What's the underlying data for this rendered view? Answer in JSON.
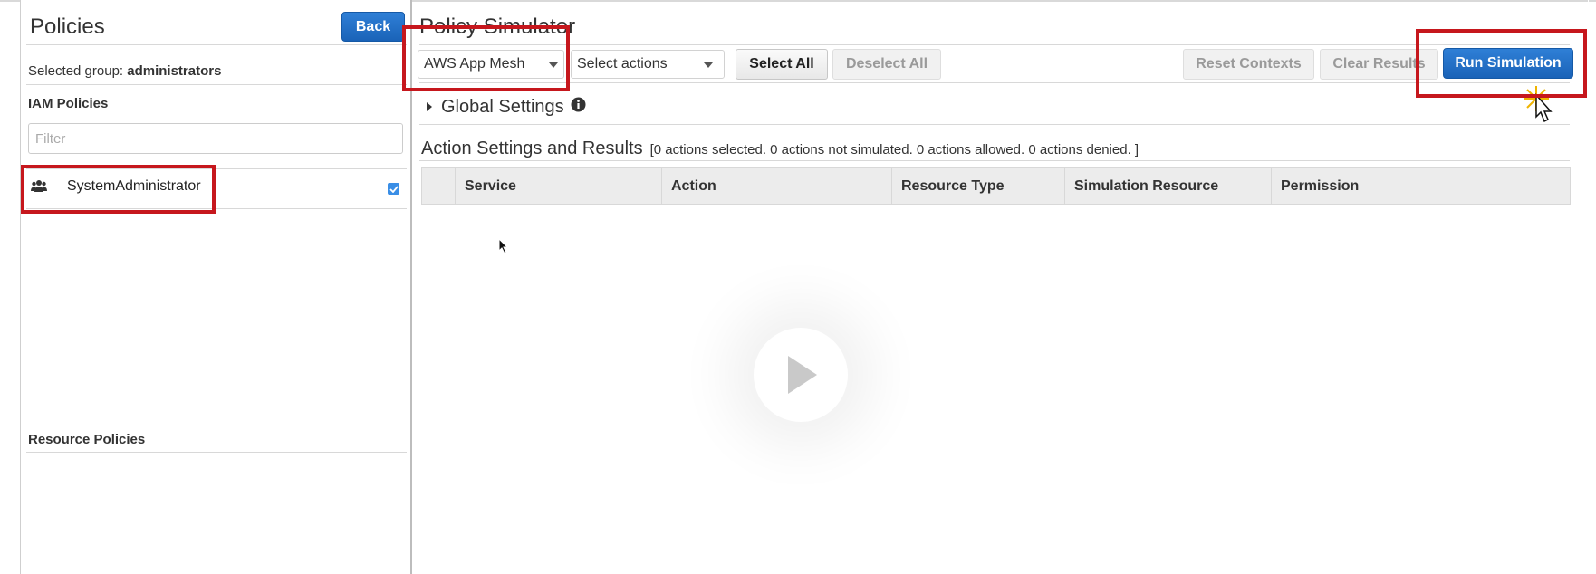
{
  "left": {
    "title": "Policies",
    "back_label": "Back",
    "selected_group_label": "Selected group: ",
    "selected_group_name": "administrators",
    "iam_policies_heading": "IAM Policies",
    "filter_placeholder": "Filter",
    "policies": [
      {
        "name": "SystemAdministrator",
        "checked": true,
        "icon": "users-icon"
      }
    ],
    "resource_policies_heading": "Resource Policies"
  },
  "main": {
    "title": "Policy Simulator",
    "service_select_value": "AWS App Mesh",
    "actions_select_value": "Select actions",
    "select_all_label": "Select All",
    "deselect_all_label": "Deselect All",
    "reset_contexts_label": "Reset Contexts",
    "clear_results_label": "Clear Results",
    "run_simulation_label": "Run Simulation",
    "global_settings_label": "Global Settings",
    "action_settings_title": "Action Settings and Results",
    "action_summary": "[0 actions selected. 0 actions not simulated. 0 actions allowed. 0 actions denied. ]",
    "table_headers": [
      "Service",
      "Action",
      "Resource Type",
      "Simulation Resource",
      "Permission"
    ]
  },
  "colors": {
    "primary_button": "#1a63b8",
    "highlight_red": "#c6171d"
  }
}
